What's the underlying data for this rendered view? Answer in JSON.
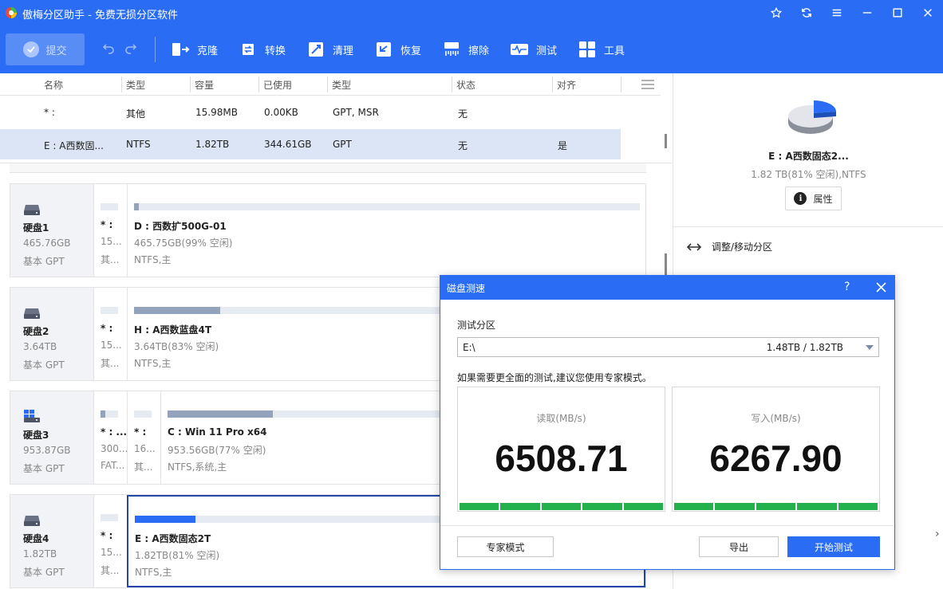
{
  "app": {
    "title": "傲梅分区助手 - 免费无损分区软件"
  },
  "toolbar": {
    "submit_label": "提交",
    "tools": [
      {
        "label": "克隆",
        "icon": "clone-icon"
      },
      {
        "label": "转换",
        "icon": "convert-icon"
      },
      {
        "label": "清理",
        "icon": "clean-icon"
      },
      {
        "label": "恢复",
        "icon": "recover-icon"
      },
      {
        "label": "擦除",
        "icon": "wipe-icon"
      },
      {
        "label": "测试",
        "icon": "test-icon"
      },
      {
        "label": "工具",
        "icon": "tools-icon"
      }
    ]
  },
  "table": {
    "headers": [
      "名称",
      "类型",
      "容量",
      "已使用",
      "类型",
      "状态",
      "对齐"
    ],
    "rows": [
      {
        "name": "* :",
        "type": "其他",
        "capacity": "15.98MB",
        "used": "0.00KB",
        "fs": "GPT, MSR",
        "status": "无",
        "align": ""
      },
      {
        "name": "E : A西数固...",
        "type": "NTFS",
        "capacity": "1.82TB",
        "used": "344.61GB",
        "fs": "GPT",
        "status": "无",
        "align": "是"
      }
    ]
  },
  "disks": [
    {
      "name": "硬盘1",
      "size": "465.76GB",
      "type": "基本 GPT",
      "partitions": [
        {
          "name": "* :",
          "detail": "15...",
          "fs": "其...",
          "used_fraction": 0
        },
        {
          "name": "D : 西数扩500G-01",
          "detail": "465.75GB(99% 空闲)",
          "fs": "NTFS,主",
          "used_fraction": 0.01
        }
      ]
    },
    {
      "name": "硬盘2",
      "size": "3.64TB",
      "type": "基本 GPT",
      "partitions": [
        {
          "name": "* :",
          "detail": "15...",
          "fs": "其...",
          "used_fraction": 0
        },
        {
          "name": "H : A西数蓝盘4T",
          "detail": "3.64TB(83% 空闲)",
          "fs": "NTFS,主",
          "used_fraction": 0.17
        }
      ]
    },
    {
      "name": "硬盘3",
      "size": "953.87GB",
      "type": "基本 GPT",
      "partitions": [
        {
          "name": "* : ...",
          "detail": "300...",
          "fs": "FAT...",
          "used_fraction": 0.25
        },
        {
          "name": "* :",
          "detail": "16...",
          "fs": "其...",
          "used_fraction": 0
        },
        {
          "name": "C : Win 11 Pro x64",
          "detail": "953.56GB(77% 空闲)",
          "fs": "NTFS,系统,主",
          "used_fraction": 0.23
        }
      ]
    },
    {
      "name": "硬盘4",
      "size": "1.82TB",
      "type": "基本 GPT",
      "partitions": [
        {
          "name": "* :",
          "detail": "15...",
          "fs": "其...",
          "used_fraction": 0
        },
        {
          "name": "E : A西数固态2T",
          "detail": "1.82TB(81% 空闲)",
          "fs": "NTFS,主",
          "used_fraction": 0.19
        }
      ]
    }
  ],
  "right_panel": {
    "name": "E : A西数固态2...",
    "detail": "1.82 TB(81% 空闲),NTFS",
    "properties_label": "属性",
    "action_label": "调整/移动分区",
    "used_fraction": 0.19
  },
  "dialog": {
    "title": "磁盘测速",
    "help": "?",
    "test_partition_label": "测试分区",
    "selected_partition": "E:\\",
    "selected_size": "1.48TB / 1.82TB",
    "hint": "如果需要更全面的测试,建议您使用专家模式。",
    "read_label": "读取(MB/s)",
    "read_value": "6508.71",
    "write_label": "写入(MB/s)",
    "write_value": "6267.90",
    "expert_label": "专家模式",
    "export_label": "导出",
    "start_label": "开始测试"
  },
  "colors": {
    "accent": "#2a6df4",
    "meter": "#22b14c",
    "selected_row": "#dbe5f5"
  }
}
